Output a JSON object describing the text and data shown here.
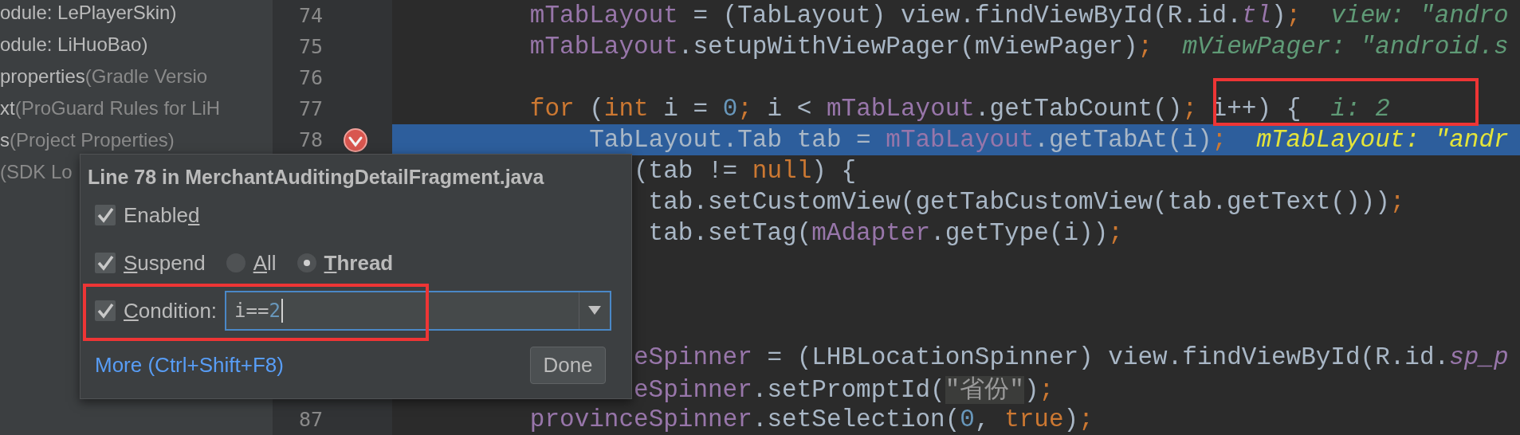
{
  "project_tree": {
    "items": [
      {
        "name": "odule: LePlayerSkin)"
      },
      {
        "name": "odule: LiHuoBao)"
      },
      {
        "name": "properties",
        "detail": "(Gradle Versio"
      },
      {
        "name": "xt",
        "detail": "(ProGuard Rules for LiH"
      },
      {
        "name": "s",
        "detail": "(Project Properties)"
      },
      {
        "detail": "(SDK Lo"
      }
    ]
  },
  "editor": {
    "lines": [
      {
        "kind": "full",
        "number": "74",
        "current": false,
        "breakpoint": false,
        "segments": [
          {
            "kind": "field",
            "text": "        mTabLayout"
          },
          {
            "kind": "text",
            "text": " = (TabLayout) view.findViewById(R.id."
          },
          {
            "kind": "field_italic",
            "text": "tl"
          },
          {
            "kind": "text",
            "text": ")"
          },
          {
            "kind": "keyword",
            "text": ";"
          },
          {
            "kind": "value",
            "text": "  view: \"andro"
          }
        ]
      },
      {
        "kind": "full",
        "number": "75",
        "current": false,
        "breakpoint": false,
        "segments": [
          {
            "kind": "field",
            "text": "        mTabLayout"
          },
          {
            "kind": "text",
            "text": ".setupWithViewPager(mViewPager)"
          },
          {
            "kind": "keyword",
            "text": ";"
          },
          {
            "kind": "value",
            "text": "  mViewPager: \"android.s"
          }
        ]
      },
      {
        "kind": "full",
        "number": "76",
        "current": false,
        "breakpoint": false
      },
      {
        "kind": "full",
        "number": "77",
        "current": false,
        "breakpoint": false,
        "segments": [
          {
            "kind": "keyword",
            "text": "        for"
          },
          {
            "kind": "text",
            "text": " ("
          },
          {
            "kind": "keyword",
            "text": "int"
          },
          {
            "kind": "text",
            "text": " i = "
          },
          {
            "kind": "number",
            "text": "0"
          },
          {
            "kind": "keyword",
            "text": ";"
          },
          {
            "kind": "text",
            "text": " i < "
          },
          {
            "kind": "field",
            "text": "mTabLayout"
          },
          {
            "kind": "text",
            "text": ".getTabCount()"
          },
          {
            "kind": "keyword",
            "text": ";"
          },
          {
            "kind": "text",
            "text": " i++) {"
          },
          {
            "kind": "value",
            "text": "  i: 2"
          }
        ]
      },
      {
        "kind": "full",
        "number": "78",
        "current": true,
        "breakpoint": true,
        "segments": [
          {
            "kind": "text",
            "text": "            TabLayout.Tab tab = "
          },
          {
            "kind": "field",
            "text": "mTabLayout"
          },
          {
            "kind": "text",
            "text": ".getTabAt(i)"
          },
          {
            "kind": "keyword",
            "text": ";"
          },
          {
            "kind": "value",
            "text": "  mTabLayout: \"andr"
          }
        ]
      },
      {
        "kind": "partial",
        "current": false,
        "breakpoint": false,
        "segments": [
          {
            "kind": "text",
            "text": "(tab != "
          },
          {
            "kind": "keyword",
            "text": "null"
          },
          {
            "kind": "text",
            "text": ") {"
          }
        ]
      },
      {
        "kind": "partial",
        "current": false,
        "breakpoint": false,
        "segments": [
          {
            "kind": "text",
            "text": " tab.setCustomView(getTabCustomView(tab.getText()))"
          },
          {
            "kind": "keyword",
            "text": ";"
          }
        ]
      },
      {
        "kind": "partial",
        "current": false,
        "breakpoint": false,
        "segments": [
          {
            "kind": "text",
            "text": " tab.setTag("
          },
          {
            "kind": "field",
            "text": "mAdapter"
          },
          {
            "kind": "text",
            "text": ".getType(i))"
          },
          {
            "kind": "keyword",
            "text": ";"
          }
        ]
      },
      {
        "kind": "partial",
        "current": false,
        "breakpoint": false
      },
      {
        "kind": "partial",
        "current": false,
        "breakpoint": false
      },
      {
        "kind": "partial",
        "current": false,
        "breakpoint": false
      },
      {
        "kind": "partial",
        "current": false,
        "breakpoint": false,
        "segments": [
          {
            "kind": "field",
            "text": "eSpinner"
          },
          {
            "kind": "text",
            "text": " = (LHBLocationSpinner) view.findViewById(R.id."
          },
          {
            "kind": "field_italic",
            "text": "sp_p"
          }
        ]
      },
      {
        "kind": "partial",
        "current": false,
        "breakpoint": false,
        "segments": [
          {
            "kind": "field",
            "text": "eSpinner"
          },
          {
            "kind": "text",
            "text": ".setPromptId("
          },
          {
            "kind": "string",
            "text": "\"省份\""
          },
          {
            "kind": "text",
            "text": ")"
          },
          {
            "kind": "keyword",
            "text": ";"
          }
        ]
      },
      {
        "kind": "full",
        "number": "87",
        "current": false,
        "breakpoint": false,
        "segments": [
          {
            "kind": "field",
            "text": "        provinceSpinner"
          },
          {
            "kind": "text",
            "text": ".setSelection("
          },
          {
            "kind": "number",
            "text": "0"
          },
          {
            "kind": "text",
            "text": ", "
          },
          {
            "kind": "keyword",
            "text": "true"
          },
          {
            "kind": "text",
            "text": ")"
          },
          {
            "kind": "keyword",
            "text": ";"
          }
        ]
      }
    ]
  },
  "breakpoint_popup": {
    "title": "Line 78 in MerchantAuditingDetailFragment.java",
    "enabled": {
      "checked": true,
      "label": [
        {
          "text": "Enable",
          "mnemonic": false
        },
        {
          "text": "d",
          "mnemonic": true
        }
      ]
    },
    "suspend": {
      "checked": true,
      "label": [
        {
          "text": "S",
          "mnemonic": true
        },
        {
          "text": "uspend",
          "mnemonic": false
        }
      ]
    },
    "suspend_options": [
      {
        "selected": false,
        "label": [
          {
            "text": "A",
            "mnemonic": true
          },
          {
            "text": "ll",
            "mnemonic": false
          }
        ]
      },
      {
        "selected": true,
        "label": [
          {
            "text": "T",
            "mnemonic": true
          },
          {
            "text": "hread",
            "mnemonic": false
          }
        ]
      }
    ],
    "condition": {
      "checked": true,
      "label": [
        {
          "text": "C",
          "mnemonic": true
        },
        {
          "text": "ondition:",
          "mnemonic": false
        }
      ],
      "value": [
        {
          "kind": "text",
          "text": "i=="
        },
        {
          "kind": "number",
          "text": "2"
        }
      ]
    },
    "more_link": "More (Ctrl+Shift+F8)",
    "done_button": "Done"
  }
}
